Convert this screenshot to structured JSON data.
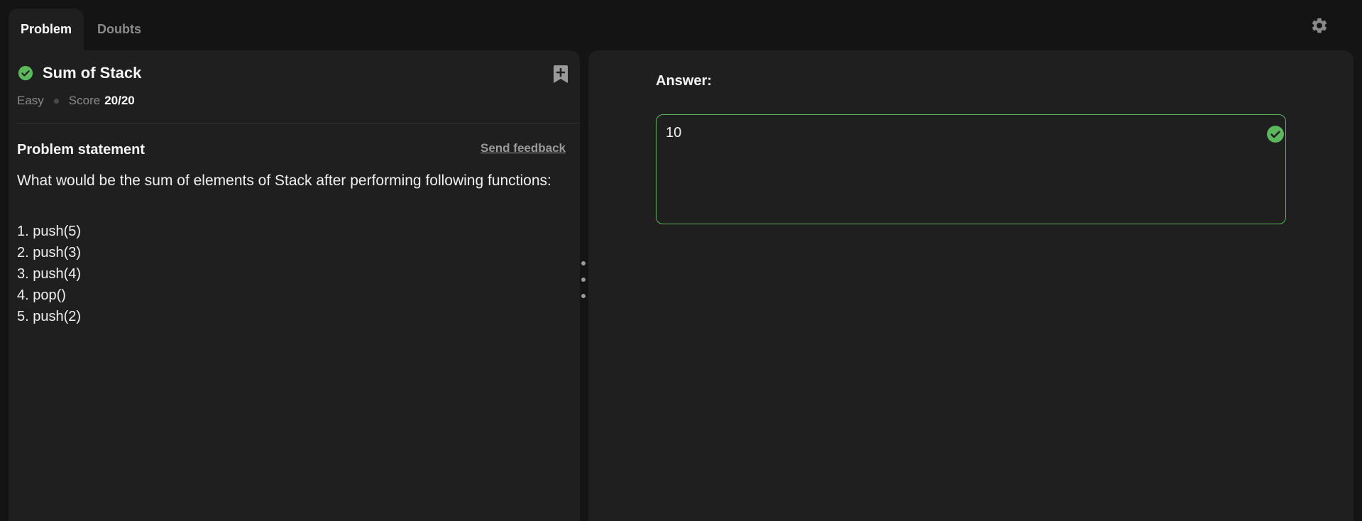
{
  "tabs": [
    {
      "label": "Problem",
      "active": true
    },
    {
      "label": "Doubts",
      "active": false
    }
  ],
  "settings_icon": "gear-icon",
  "problem": {
    "title": "Sum of Stack",
    "status_icon": "check-circle-icon",
    "bookmark_icon": "bookmark-add-icon",
    "difficulty": "Easy",
    "score_label": "Score",
    "score_value": "20/20",
    "section_title": "Problem statement",
    "feedback_link": "Send feedback",
    "statement": "What would be the sum of elements of Stack after performing following functions:",
    "steps": [
      "1. push(5)",
      "2. push(3)",
      "3. push(4)",
      "4. pop()",
      "5. push(2)"
    ]
  },
  "answer": {
    "label": "Answer:",
    "value": "10",
    "status_icon": "check-circle-icon"
  },
  "colors": {
    "background": "#141414",
    "panel": "#1f1f1f",
    "accent_green": "#5cb85c",
    "muted_text": "#8a8a8a"
  }
}
